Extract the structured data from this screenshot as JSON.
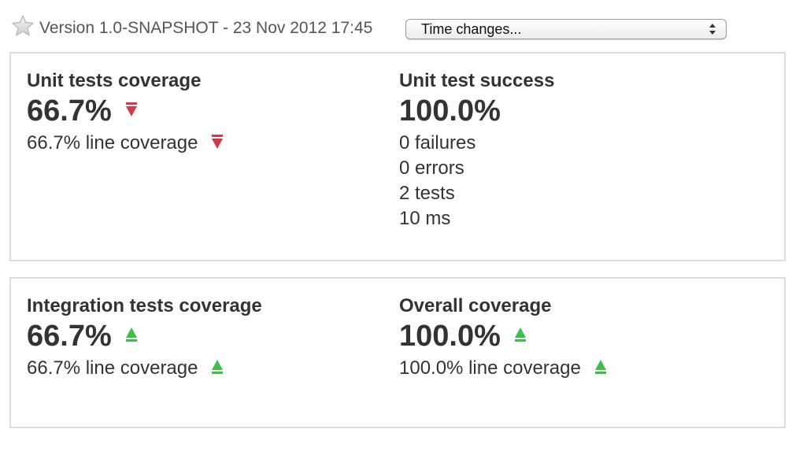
{
  "header": {
    "version_label": "Version 1.0-SNAPSHOT - 23 Nov 2012 17:45",
    "time_changes_select": "Time changes..."
  },
  "colors": {
    "trend_down": "#d9364a",
    "trend_up": "#3dbf4a",
    "panel_border": "#dcdcdc",
    "text": "#333333"
  },
  "icons": {
    "favorite": "star-icon",
    "trend_down": "trend-down-icon",
    "trend_up": "trend-up-icon",
    "select_arrows": "updown-arrows-icon"
  },
  "widgets": {
    "unit_coverage": {
      "title": "Unit tests coverage",
      "value": "66.7%",
      "line_coverage": "66.7% line coverage",
      "trend": "down"
    },
    "unit_success": {
      "title": "Unit test success",
      "value": "100.0%",
      "failures": "0 failures",
      "errors": "0 errors",
      "tests": "2 tests",
      "duration": "10 ms"
    },
    "integration_coverage": {
      "title": "Integration tests coverage",
      "value": "66.7%",
      "line_coverage": "66.7% line coverage",
      "trend": "up"
    },
    "overall_coverage": {
      "title": "Overall coverage",
      "value": "100.0%",
      "line_coverage": "100.0% line coverage",
      "trend": "up"
    }
  }
}
